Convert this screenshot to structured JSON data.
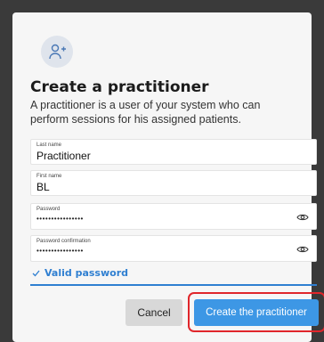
{
  "dialog": {
    "title": "Create a practitioner",
    "description": "A practitioner is a user of your system who can perform sessions for his assigned patients.",
    "icon": "add-user-icon"
  },
  "fields": {
    "last_name": {
      "label": "Last name",
      "value": "Practitioner"
    },
    "first_name": {
      "label": "First name",
      "value": "BL"
    },
    "password": {
      "label": "Password",
      "value": "••••••••••••••••"
    },
    "password_confirmation": {
      "label": "Password confirmation",
      "value": "••••••••••••••••"
    }
  },
  "validation": {
    "text": "Valid password",
    "color": "#2f7fd1"
  },
  "buttons": {
    "cancel": "Cancel",
    "create": "Create the practitioner"
  },
  "colors": {
    "primary": "#3d97e5",
    "highlight": "#e0262b"
  }
}
